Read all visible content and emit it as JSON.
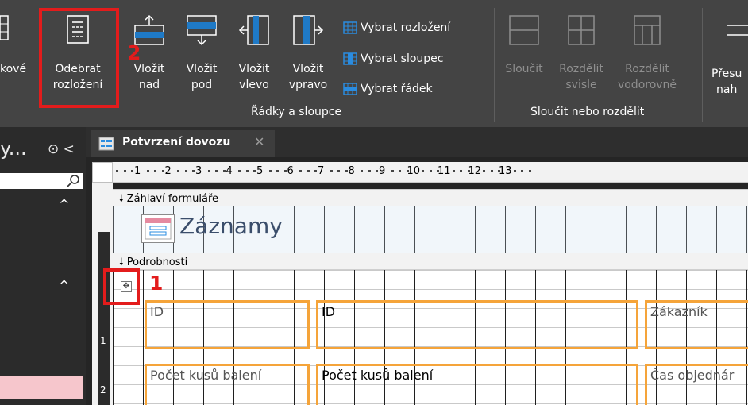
{
  "ribbon": {
    "partial_label": "kové",
    "remove_layout": {
      "line1": "Odebrat",
      "line2": "rozložení"
    },
    "insert_above": {
      "line1": "Vložit",
      "line2": "nad"
    },
    "insert_below": {
      "line1": "Vložit",
      "line2": "pod"
    },
    "insert_left": {
      "line1": "Vložit",
      "line2": "vlevo"
    },
    "insert_right": {
      "line1": "Vložit",
      "line2": "vpravo"
    },
    "select_layout": "Vybrat rozložení",
    "select_column": "Vybrat sloupec",
    "select_row": "Vybrat řádek",
    "group_rows_cols": "Řádky a sloupce",
    "merge": "Sloučit",
    "split_vert": {
      "line1": "Rozdělit",
      "line2": "svisle"
    },
    "split_horiz": {
      "line1": "Rozdělit",
      "line2": "vodorovně"
    },
    "group_merge_split": "Sloučit nebo rozdělit",
    "move_partial": {
      "line1": "Přesu",
      "line2": "nah"
    }
  },
  "annotations": {
    "one": "1",
    "two": "2"
  },
  "nav": {
    "title": "y...",
    "icons": "⊙ <"
  },
  "doc": {
    "tab_label": "Potvrzení dovozu",
    "ruler_numbers": [
      "1",
      "2",
      "3",
      "4",
      "5",
      "6",
      "7",
      "8",
      "9",
      "10",
      "11",
      "12",
      "13"
    ],
    "vertical_ruler_numbers": [
      "1",
      "2"
    ],
    "section_header": "Záhlaví formuláře",
    "section_detail": "Podrobnosti",
    "form_title": "Záznamy",
    "row1": {
      "label": "ID",
      "value": "ID",
      "label2": "Zákazník"
    },
    "row2": {
      "label": "Počet kusů balení",
      "value": "Počet kusů balení",
      "label2": "Čas objednár"
    }
  },
  "colors": {
    "ribbon_bg": "#444444",
    "highlight_red": "#e31c1c",
    "control_orange": "#f5a43a",
    "nav_selected": "#f6c6cc"
  }
}
